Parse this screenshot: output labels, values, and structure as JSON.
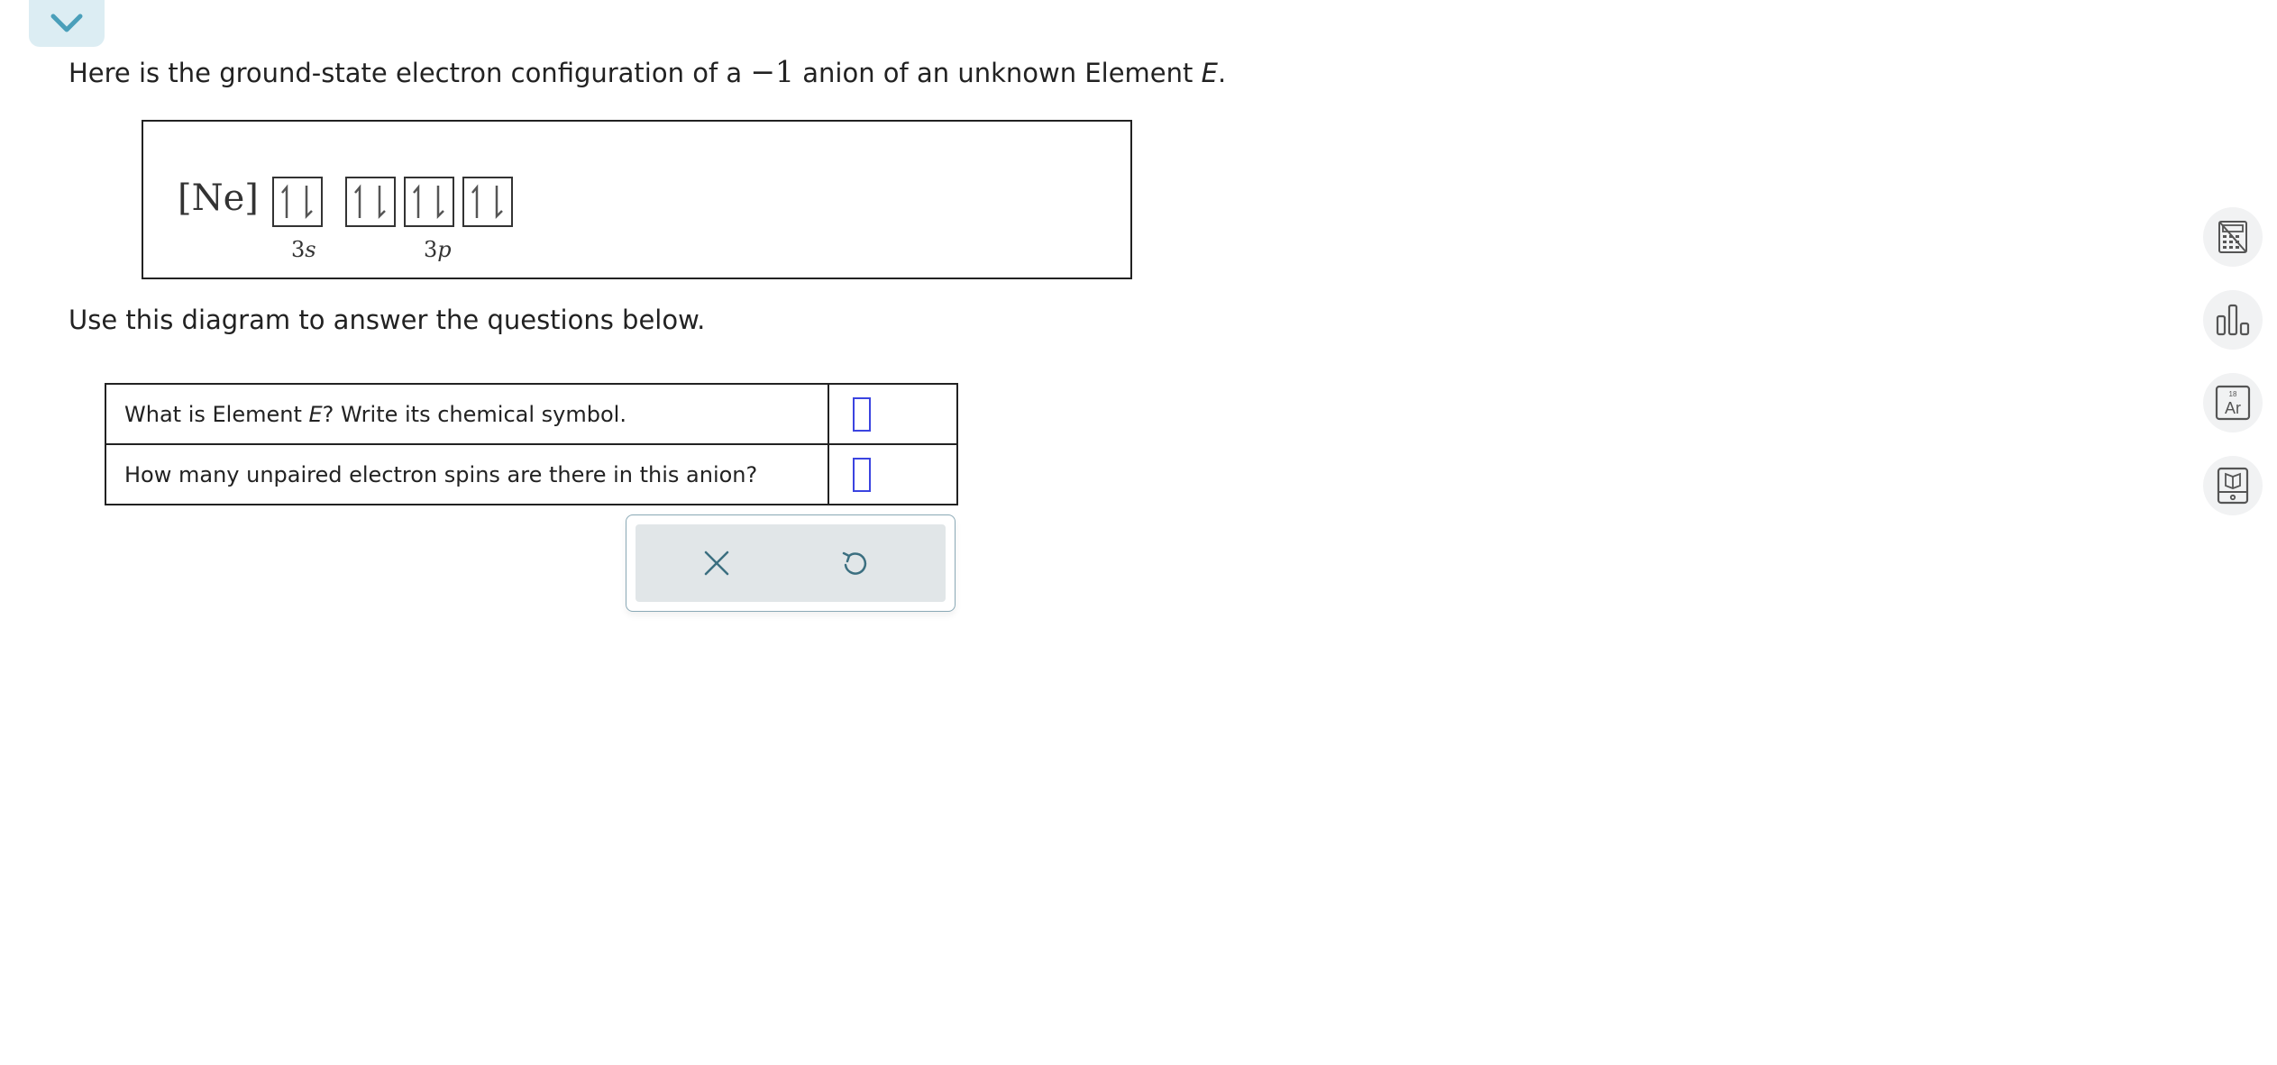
{
  "prompt": {
    "before": "Here is the ground-state electron configuration of a ",
    "charge_sign": "−",
    "charge_value": "1",
    "after": " anion of an unknown Element ",
    "element": "E",
    "end": "."
  },
  "diagram": {
    "core": "[Ne]",
    "orbitals": [
      {
        "sublevel": "3s",
        "electrons": "↑↓"
      },
      {
        "sublevel": "3p",
        "electrons": "↑↓"
      },
      {
        "sublevel": "3p",
        "electrons": "↑↓"
      },
      {
        "sublevel": "3p",
        "electrons": "↑↓"
      }
    ],
    "label_3s_num": "3",
    "label_3s_letter": "s",
    "label_3p_num": "3",
    "label_3p_letter": "p"
  },
  "instruction": "Use this diagram to answer the questions below.",
  "questions": {
    "q1_before": "What is Element ",
    "q1_element": "E",
    "q1_after": "? Write its chemical symbol.",
    "q1_value": "",
    "q2": "How many unpaired electron spins are there in this anion?",
    "q2_value": ""
  },
  "actions": {
    "clear_icon": "x-icon",
    "undo_icon": "undo-icon"
  },
  "tools": {
    "calculator_icon": "calculator-icon",
    "chart_icon": "bar-chart-icon",
    "periodic_icon": "periodic-table-icon",
    "periodic_number": "18",
    "periodic_symbol": "Ar",
    "reference_icon": "reference-book-icon"
  },
  "colors": {
    "accent": "#4a9fba",
    "answer_box": "#3b44e0",
    "action_bar": "#e1e6e8"
  }
}
